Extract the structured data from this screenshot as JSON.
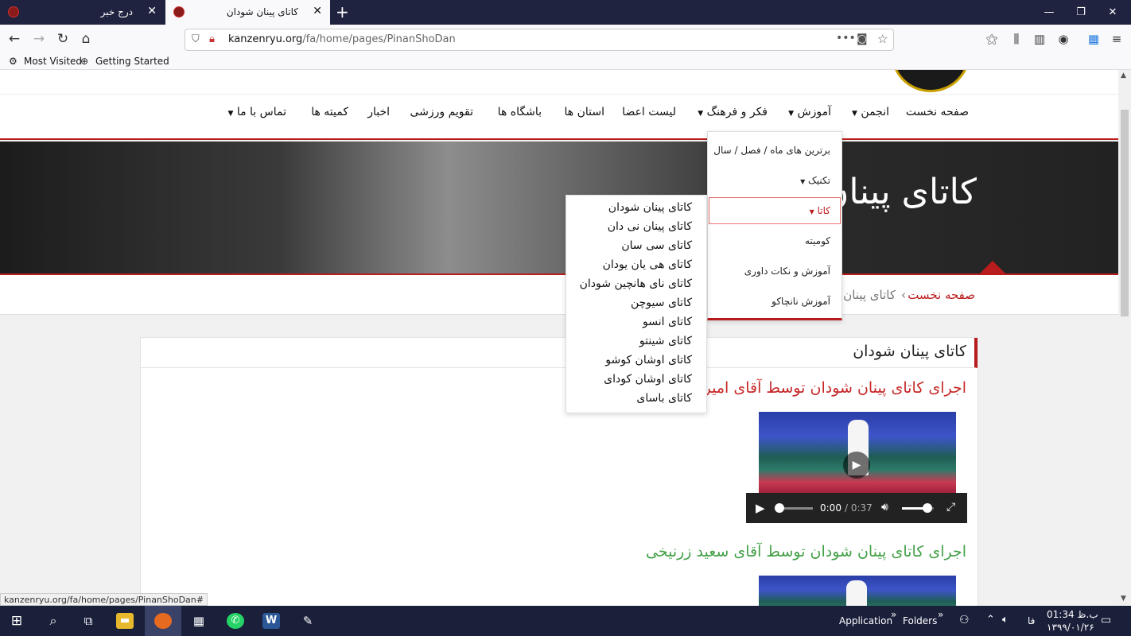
{
  "browser": {
    "tabs": [
      {
        "title": "درج خبر",
        "active": false
      },
      {
        "title": "کاتای پینان شودان",
        "active": true
      }
    ],
    "new_tab": "+",
    "url_domain": "kanzenryu.org",
    "url_path": "/fa/home/pages/PinanShoDan",
    "bookmarks": [
      "Most Visited",
      "Getting Started"
    ],
    "status_url": "kanzenryu.org/fa/home/pages/PinanShoDan#"
  },
  "site": {
    "menu": [
      "صفحه نخست",
      "انجمن",
      "آموزش",
      "فکر و فرهنگ",
      "لیست اعضا",
      "استان ها",
      "باشگاه ها",
      "تقویم ورزشی",
      "اخبار",
      "کمیته ها",
      "تماس با ما"
    ],
    "hero_title": "کاتای پینان شودان",
    "breadcrumb": {
      "home": "صفحه نخست",
      "sep": "›",
      "current": "کاتای پینان شودان"
    },
    "dropdown_training": [
      "برترین های ماه / فصل / سال",
      "تکنیک",
      "کاتا",
      "کومیته",
      "آموزش و نکات داوری",
      "آموزش نانچاکو"
    ],
    "dropdown_kata": [
      "کاتای پینان شودان",
      "کاتای پینان نی دان",
      "کاتای سی سان",
      "کاتای هی یان یودان",
      "کاتای نای هانچین شودان",
      "کاتای سیوچن",
      "کاتای انسو",
      "کاتای شینتو",
      "کاتای اوشان کوشو",
      "کاتای اوشان کودای",
      "کاتای باسای"
    ],
    "card_title": "کاتای پینان شودان",
    "video1_title": "اجرای کاتای پینان شودان توسط آقای امیر حسین",
    "video1_time": "0:00",
    "video1_duration": "/ 0:37",
    "video1_progress": 0,
    "video1_volume": 0.8,
    "video2_title": "اجرای کاتای پینان شودان توسط آقای سعید زرنیخی"
  },
  "taskbar": {
    "labels": [
      "Application",
      "Folders"
    ],
    "lang": "فا",
    "time": "01:34 ب.ظ",
    "date": "۱۳۹۹/۰۱/۲۶"
  },
  "colors": {
    "accent": "#b91c1c",
    "link_red": "#c62828",
    "link_green": "#43a047",
    "taskbar": "#1a1f3a",
    "tabbar": "#202340"
  }
}
